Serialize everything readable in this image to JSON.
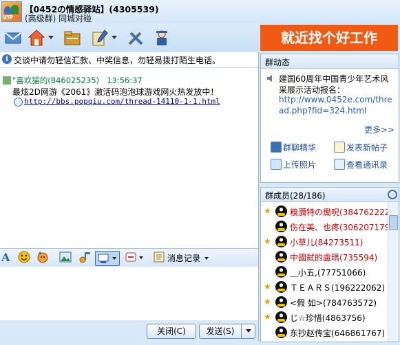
{
  "title": {
    "name": "【0452の情感驿站】",
    "id": "(4305539)",
    "subtitle": "(高级群) 同城对碰"
  },
  "toolbar": {
    "icons": [
      "mail-icon",
      "home-icon",
      "folder-icon",
      "edit-icon",
      "tools-icon",
      "support-icon"
    ]
  },
  "notice": "交谈中请勿轻信汇款、中奖信息，勿轻易拨打陌生电话。",
  "chat": {
    "sender": "\"喜欢猫的",
    "sender_id": "(846025235)",
    "time": "13:56:37",
    "message": "最炫2D网游《2061》激活码泡泡球游戏网火热发放中！",
    "link": "http://bbs.popqiu.com/thread-14110-1-1.html"
  },
  "input_toolbar": {
    "history_label": "消息记录"
  },
  "buttons": {
    "close": "关闭(C)",
    "send": "发送(S)"
  },
  "ad": {
    "text": "就近找个好工作",
    "bg_color": "#f15a13"
  },
  "news": {
    "header": "群动态",
    "line1": "建国60周年中国青少年艺术风",
    "line2": "采展示活动报名：",
    "link": "http://www.0452e.com/thread.php?fid=324.html",
    "more": "更多>>",
    "links": [
      "群聊精华",
      "发表新帖子",
      "上传照片",
      "查看通讯录"
    ]
  },
  "members": {
    "header": "群成员(28/186)",
    "list": [
      {
        "star": true,
        "name": "糗瀰特の爋呪",
        "id": "(384762222)",
        "color": "#d10000"
      },
      {
        "star": false,
        "name": "伤在美、也疼",
        "id": "(306207179)",
        "color": "#d10000"
      },
      {
        "star": true,
        "name": "小草儿",
        "id": "(84273511)",
        "color": "#d10000"
      },
      {
        "star": false,
        "name": "中國弑的盧瑪",
        "id": "(735594)",
        "color": "#d10000"
      },
      {
        "star": false,
        "name": "＿小五,",
        "id": "(77751066)",
        "color": "#000000"
      },
      {
        "star": true,
        "name": "ＴＥＡＲＳ",
        "id": "(196222062)",
        "color": "#000000"
      },
      {
        "star": true,
        "name": "<假 如>",
        "id": "(784763572)",
        "color": "#000000"
      },
      {
        "star": true,
        "name": "じ☆珍惜",
        "id": "(4863756)",
        "color": "#000000"
      },
      {
        "star": false,
        "name": "东抄赵传宝",
        "id": "(646861767)",
        "color": "#000000"
      }
    ]
  }
}
